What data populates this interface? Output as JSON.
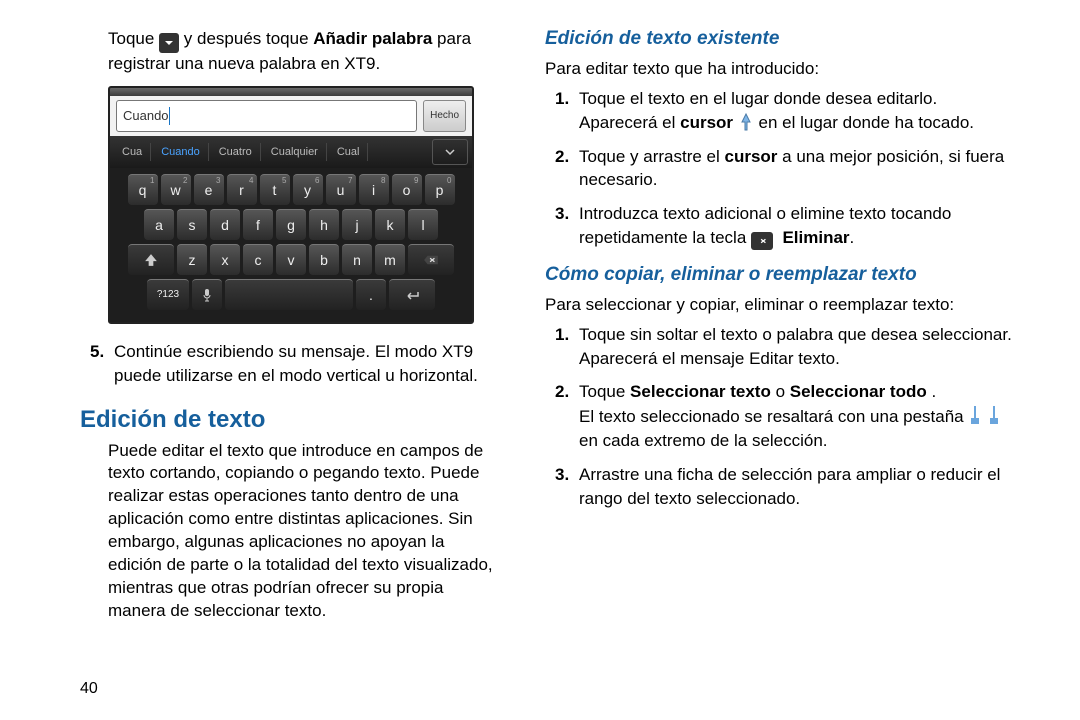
{
  "page_number": "40",
  "left": {
    "intro_a": "Toque ",
    "intro_b": " y después toque ",
    "intro_bold": "Añadir palabra",
    "intro_c": " para registrar una nueva palabra en XT9.",
    "step5_num": "5.",
    "step5": "Continúe escribiendo su mensaje. El modo XT9 puede utilizarse en el modo vertical u horizontal.",
    "h2": "Edición de texto",
    "para": "Puede editar el texto que introduce en campos de texto cortando, copiando o pegando texto. Puede realizar estas operaciones tanto dentro de una aplicación como entre distintas aplicaciones. Sin embargo, algunas aplicaciones no apoyan la edición de parte o la totalidad del texto visualizado, mientras que otras podrían ofrecer su propia manera de seleccionar texto."
  },
  "keyboard": {
    "input_value": "Cuando",
    "done": "Hecho",
    "sugg": [
      "Cua",
      "Cuando",
      "Cuatro",
      "Cualquier",
      "Cual"
    ],
    "row1": [
      "q",
      "w",
      "e",
      "r",
      "t",
      "y",
      "u",
      "i",
      "o",
      "p"
    ],
    "row1_sup": [
      "1",
      "2",
      "3",
      "4",
      "5",
      "6",
      "7",
      "8",
      "9",
      "0"
    ],
    "row2": [
      "a",
      "s",
      "d",
      "f",
      "g",
      "h",
      "j",
      "k",
      "l"
    ],
    "row3": [
      "z",
      "x",
      "c",
      "v",
      "b",
      "n",
      "m"
    ],
    "sym": "?123"
  },
  "right": {
    "h3a": "Edición de texto existente",
    "intro_a": "Para editar texto que ha introducido:",
    "a1_num": "1.",
    "a1_a": "Toque el texto en el lugar donde desea editarlo. Aparecerá el ",
    "a1_bold": "cursor",
    "a1_b": " en el lugar donde ha tocado.",
    "a2_num": "2.",
    "a2_a": "Toque y arrastre el ",
    "a2_bold": "cursor",
    "a2_b": " a una mejor posición, si fuera necesario.",
    "a3_num": "3.",
    "a3_a": "Introduzca texto adicional o elimine texto tocando repetidamente la tecla ",
    "a3_bold": "Eliminar",
    "a3_b": ".",
    "h3b": "Cómo copiar, eliminar o reemplazar texto",
    "intro_b": "Para seleccionar y copiar, eliminar o reemplazar texto:",
    "b1_num": "1.",
    "b1": "Toque sin soltar el texto o palabra que desea seleccionar. Aparecerá el mensaje Editar texto.",
    "b2_num": "2.",
    "b2_a": "Toque ",
    "b2_bold1": "Seleccionar texto",
    "b2_mid": " o ",
    "b2_bold2": "Seleccionar todo",
    "b2_b": ".",
    "b2_c": "El texto seleccionado se resaltará con una pestaña ",
    "b2_d": " en cada extremo de la selección.",
    "b3_num": "3.",
    "b3": "Arrastre una ficha de selección para ampliar o reducir el rango del texto seleccionado."
  }
}
